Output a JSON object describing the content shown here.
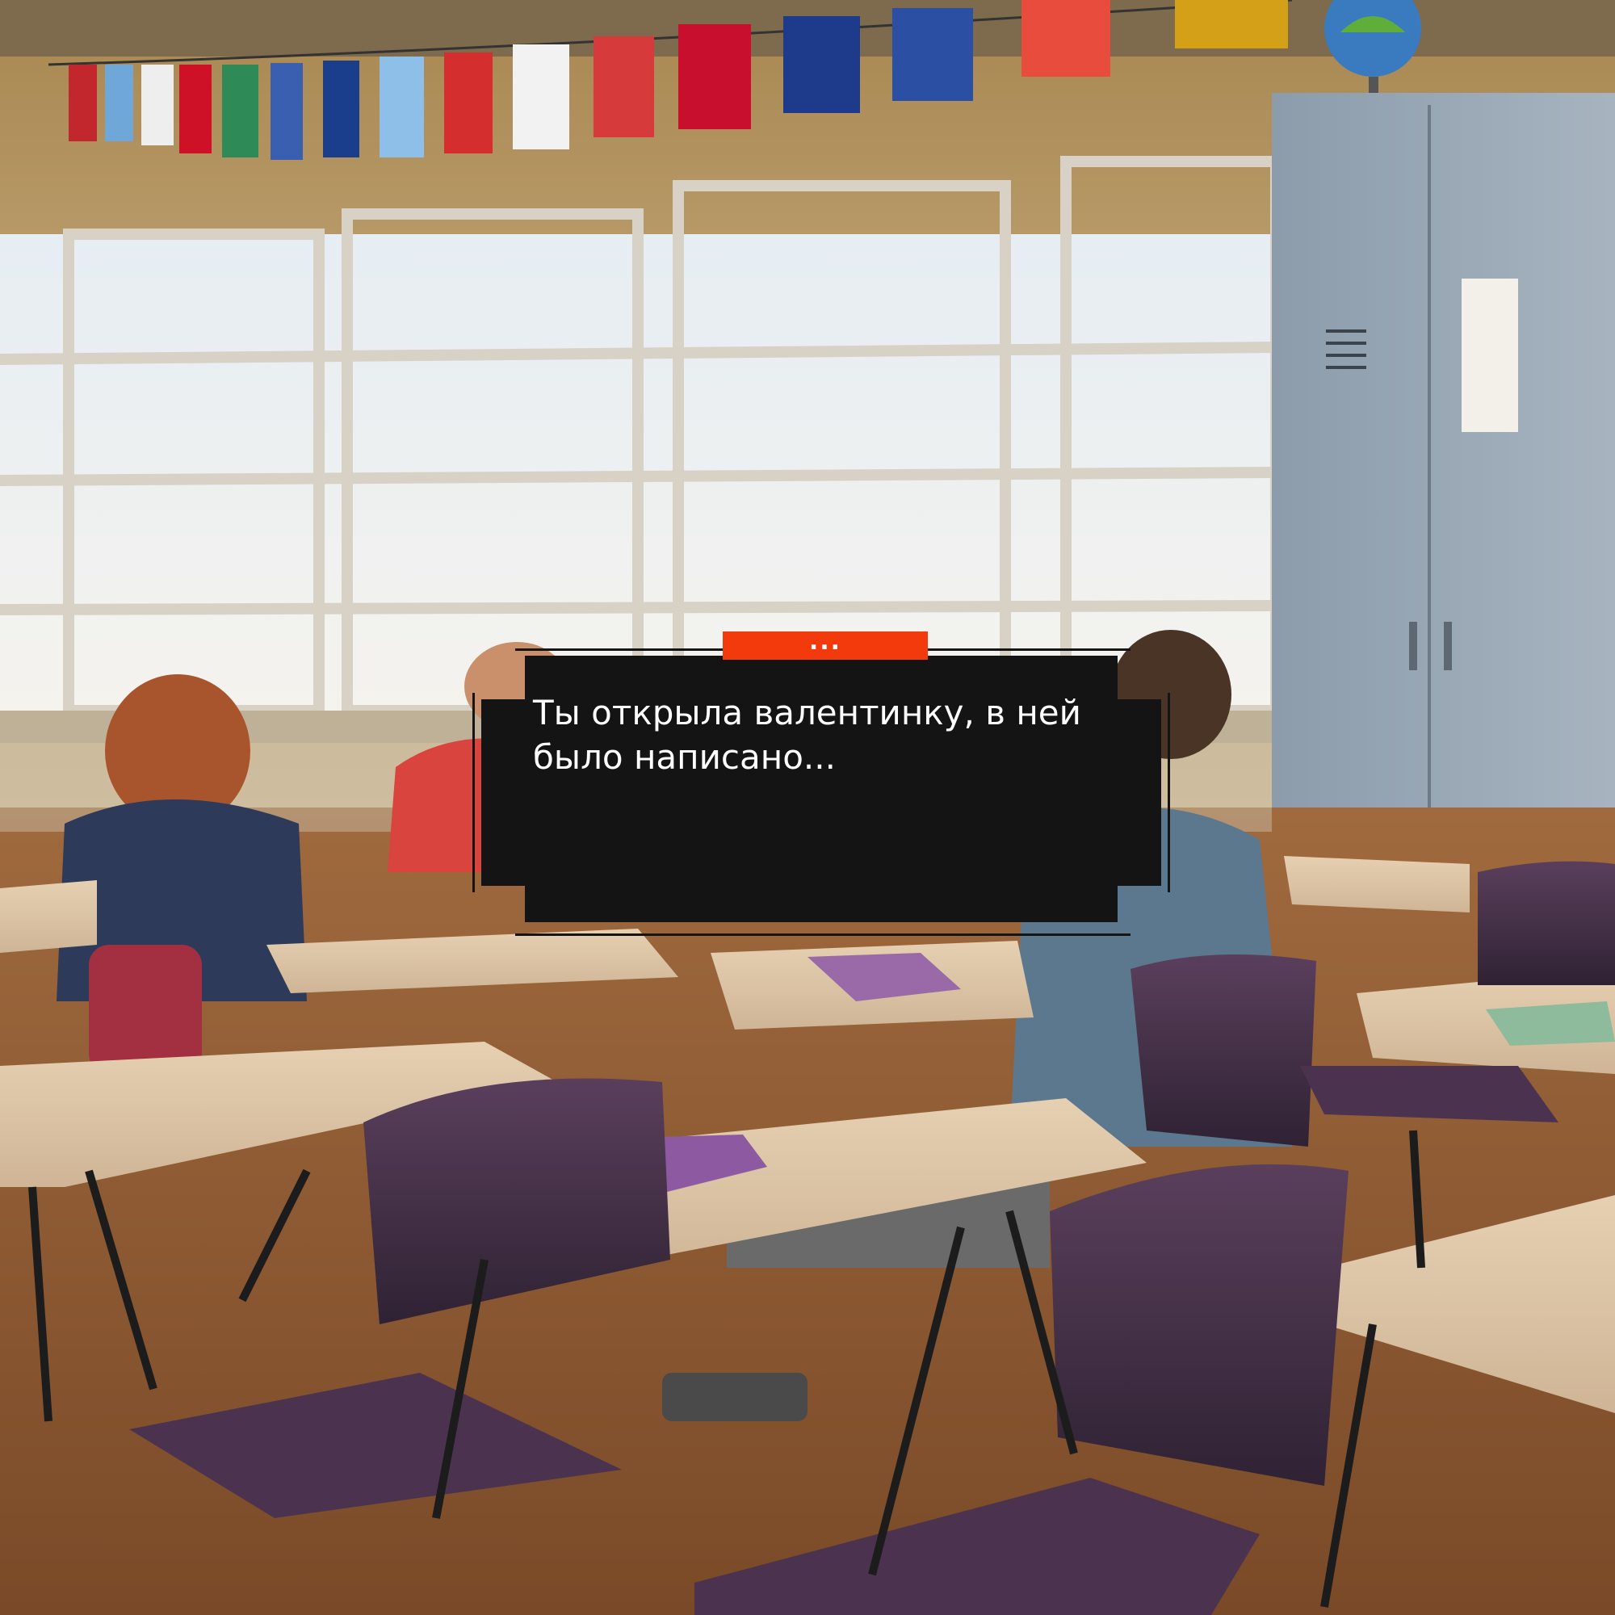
{
  "scene": {
    "setting": "classroom",
    "colors": {
      "speaker_tag": "#f23a0c",
      "dialog_bg": "#141414",
      "dialog_text": "#ffffff"
    }
  },
  "dialog": {
    "speaker": "...",
    "text": "Ты открыла валентинку, в ней было написано..."
  }
}
